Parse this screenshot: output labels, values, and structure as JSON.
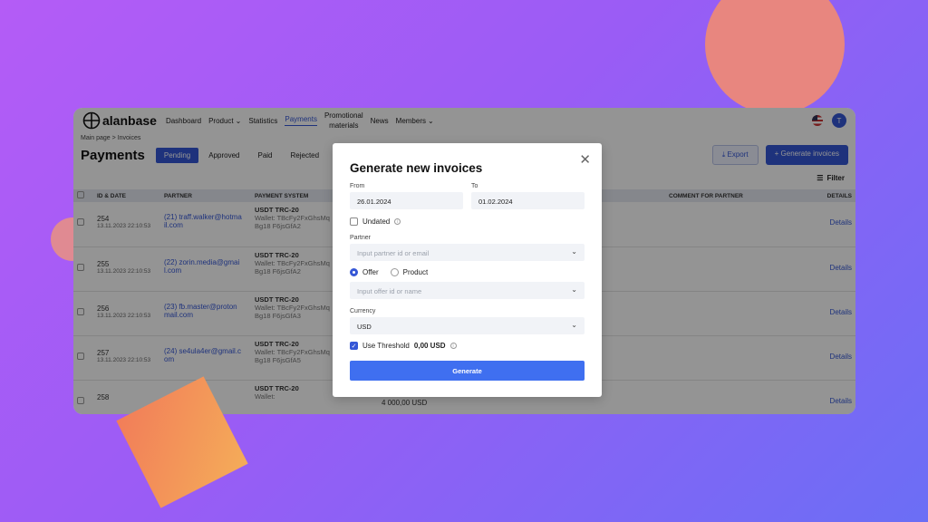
{
  "app": {
    "logo_text": "alanbase"
  },
  "nav": {
    "items": [
      "Dashboard",
      "Product",
      "Statistics",
      "Payments",
      "News",
      "Members"
    ],
    "promo_line1": "Promotional",
    "promo_line2": "materials",
    "avatar": "T"
  },
  "breadcrumb": {
    "home": "Main page",
    "sep": ">",
    "current": "Invoices"
  },
  "page": {
    "title": "Payments",
    "tabs": [
      "Pending",
      "Approved",
      "Paid",
      "Rejected"
    ],
    "export": "Export",
    "generate": "Generate invoices",
    "filter": "Filter"
  },
  "table": {
    "headers": [
      "ID & DATE",
      "PARTNER",
      "PAYMENT SYSTEM",
      "",
      "",
      "COMMENT FOR PARTNER",
      "DETAILS"
    ],
    "rows": [
      {
        "id": "254",
        "date": "13.11.2023 22:10:53",
        "partner": "(21) traff.walker@hotmail.com",
        "ps": "USDT TRC-20",
        "wallet": "Wallet: TBcFy2FxGhsMqBg18 F6jsGfA2",
        "amount": "",
        "details": "Details"
      },
      {
        "id": "255",
        "date": "13.11.2023 22:10:53",
        "partner": "(22) zorin.media@gmail.com",
        "ps": "USDT TRC-20",
        "wallet": "Wallet: TBcFy2FxGhsMqBg18 F6jsGfA2",
        "amount": "",
        "details": "Details"
      },
      {
        "id": "256",
        "date": "13.11.2023 22:10:53",
        "partner": "(23) fb.master@protonmail.com",
        "ps": "USDT TRC-20",
        "wallet": "Wallet: TBcFy2FxGhsMqBg18 F6jsGfA3",
        "amount": "",
        "details": "Details"
      },
      {
        "id": "257",
        "date": "13.11.2023 22:10:53",
        "partner": "(24) se4ula4er@gmail.com",
        "ps": "USDT TRC-20",
        "wallet": "Wallet: TBcFy2FxGhsMqBg18 F6jsGfA5",
        "amount": "",
        "details": "Details"
      },
      {
        "id": "258",
        "date": "",
        "partner": "",
        "ps": "USDT TRC-20",
        "wallet": "Wallet:",
        "amount": "4 000,00 USD",
        "details": "Details"
      }
    ]
  },
  "modal": {
    "title": "Generate new invoices",
    "from_label": "From",
    "from_value": "26.01.2024",
    "to_label": "To",
    "to_value": "01.02.2024",
    "undated": "Undated",
    "partner_label": "Partner",
    "partner_placeholder": "Input partner id or email",
    "offer": "Offer",
    "product": "Product",
    "offer_placeholder": "Input offer id or name",
    "currency_label": "Currency",
    "currency_value": "USD",
    "threshold_label": "Use Threshold",
    "threshold_value": "0,00 USD",
    "generate": "Generate"
  }
}
